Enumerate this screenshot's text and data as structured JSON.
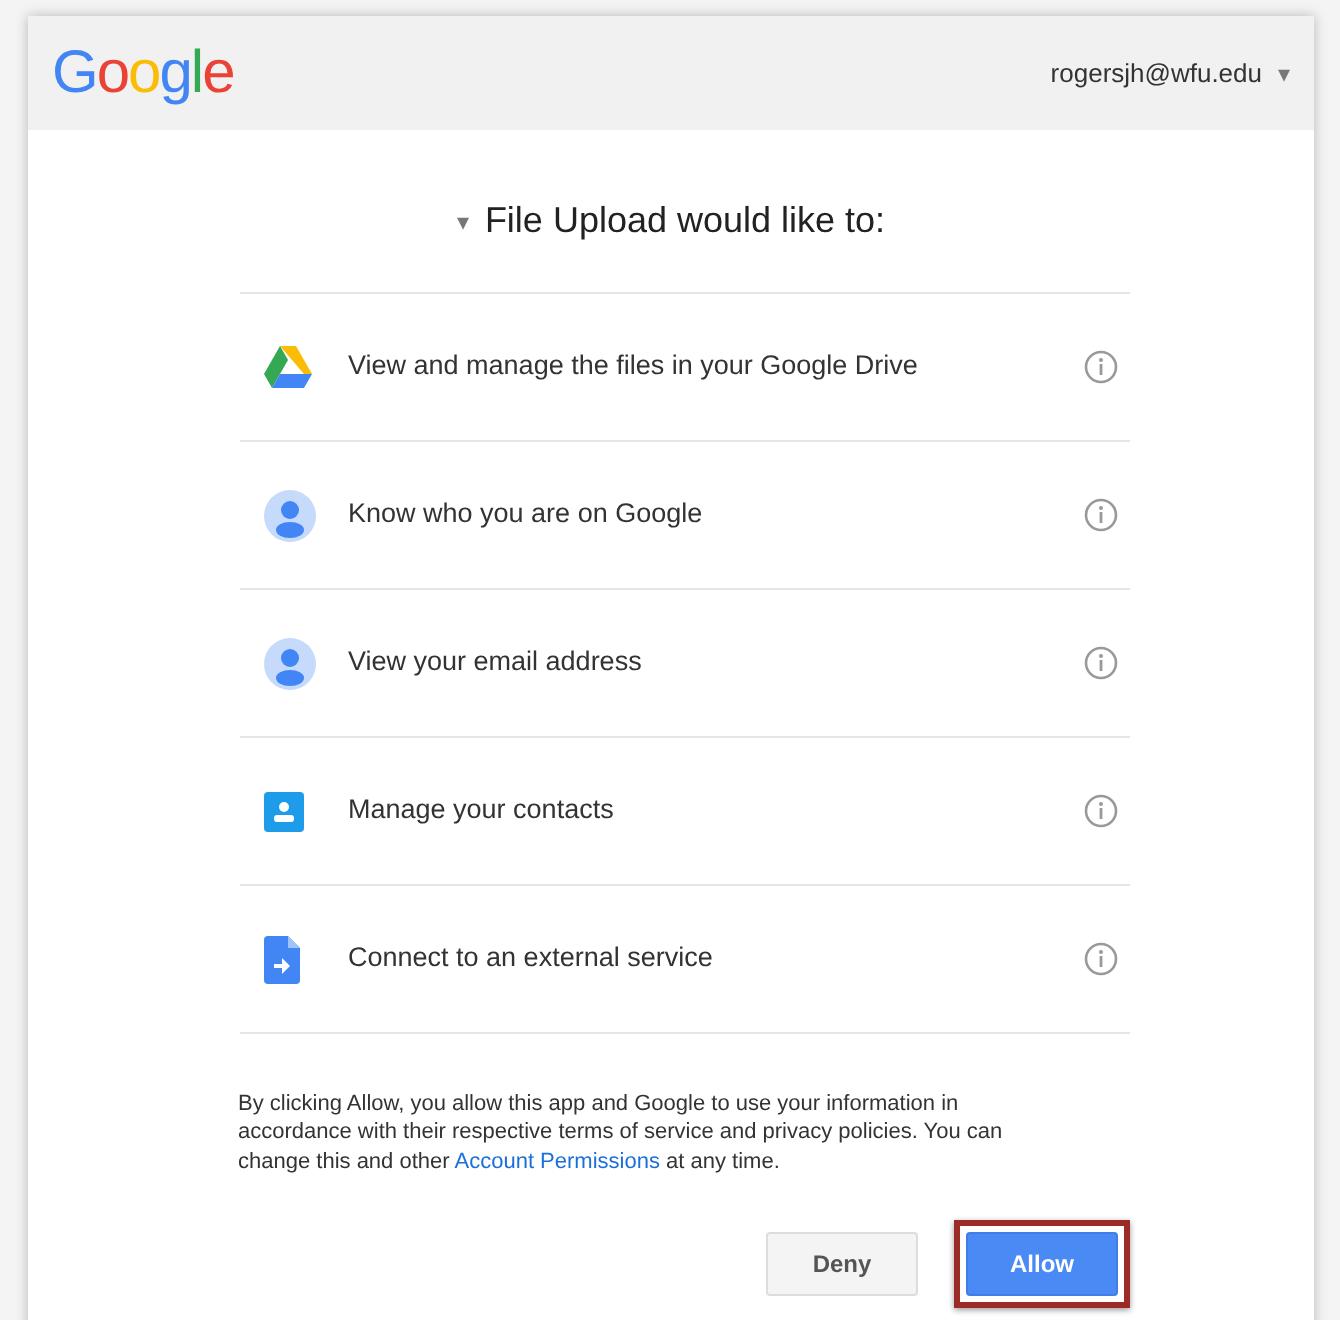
{
  "header": {
    "logo": "Google",
    "account": "rogersjh@wfu.edu",
    "account_menu": "▾"
  },
  "title": {
    "caret": "▾",
    "text": "File Upload would like to:"
  },
  "permissions": [
    {
      "kind": "drive",
      "text": "View and manage the files in your Google Drive"
    },
    {
      "kind": "person",
      "text": "Know who you are on Google"
    },
    {
      "kind": "person",
      "text": "View your email address"
    },
    {
      "kind": "contacts",
      "text": "Manage your contacts"
    },
    {
      "kind": "service",
      "text": "Connect to an external service"
    }
  ],
  "notice": {
    "before": "By clicking Allow, you allow this app and Google to use your information in accordance with their respective terms of service and privacy policies. You can change this and other ",
    "link": "Account Permissions",
    "after": " at any time."
  },
  "buttons": [
    {
      "label": "Deny",
      "kind": "secondary",
      "highlighted": false
    },
    {
      "label": "Allow",
      "kind": "primary",
      "highlighted": true
    }
  ]
}
